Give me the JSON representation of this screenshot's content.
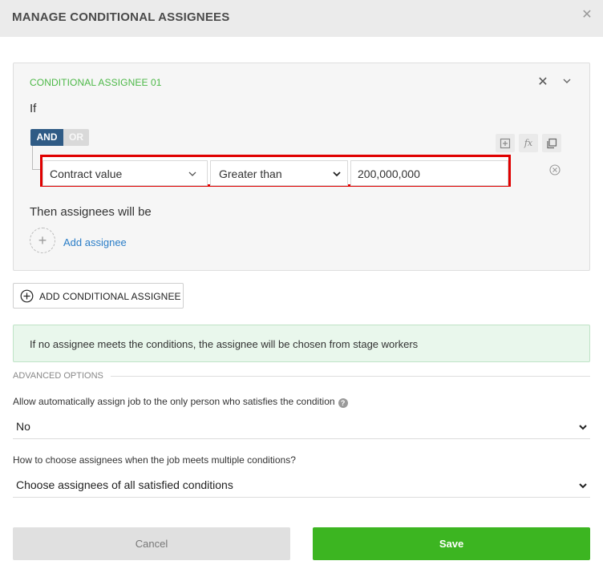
{
  "dialog": {
    "title": "MANAGE CONDITIONAL ASSIGNEES",
    "close_icon": "close-icon"
  },
  "condition_card": {
    "title": "CONDITIONAL ASSIGNEE 01",
    "if_label": "If",
    "logic": {
      "and_label": "AND",
      "or_label": "OR",
      "selected": "AND"
    },
    "toolbar_icons": [
      "add-condition-icon",
      "formula-icon",
      "copy-icon"
    ],
    "fx_glyph": "fx",
    "condition": {
      "field": "Contract value",
      "operator": "Greater than",
      "value": "200,000,000"
    },
    "then_label": "Then assignees will be",
    "add_assignee_label": "Add assignee"
  },
  "add_conditional_button": {
    "label": "ADD CONDITIONAL ASSIGNEE"
  },
  "info": {
    "text": "If no assignee meets the conditions, the assignee will be chosen from stage workers"
  },
  "advanced": {
    "section_label": "ADVANCED OPTIONS",
    "auto_assign": {
      "label": "Allow automatically assign job to the only person who satisfies the condition",
      "help_glyph": "?",
      "value": "No"
    },
    "multiple_conditions": {
      "label": "How to choose assignees when the job meets multiple conditions?",
      "value": "Choose assignees of all satisfied conditions"
    }
  },
  "footer": {
    "cancel_label": "Cancel",
    "save_label": "Save"
  },
  "colors": {
    "header_bg": "#ebebeb",
    "accent_green": "#4cb847",
    "and_blue": "#2f5b85",
    "link_blue": "#2a7dc7",
    "highlight_red": "#e00000",
    "save_green": "#3cb521",
    "info_bg": "#e9f7ec"
  }
}
